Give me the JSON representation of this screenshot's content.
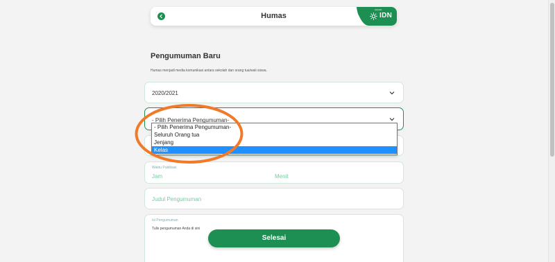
{
  "header": {
    "title": "Humas",
    "logo_small": "sekolah",
    "logo_text": "IDN"
  },
  "form": {
    "title": "Pengumuman Baru",
    "description": "Humas menjadi media komunikasi antara sekolah dan orang tua/wali siswa.",
    "year_value": "2020/2021",
    "recipient_value": "- Pilih Penerima Pengumuman-",
    "time_label": "Waktu Publikasi",
    "time_hour_placeholder": "Jam",
    "time_minute_placeholder": "Menit",
    "title_placeholder": "Judul Pengumuman",
    "content_label": "Isi Pengumuman",
    "content_placeholder": "Tulis pengumuman Anda di sini",
    "submit_label": "Selesai"
  },
  "dropdown": {
    "options": [
      "- Pilih Penerima Pengumuman-",
      "Seluruh Orang tua",
      "Jenjang",
      "Kelas"
    ],
    "highlighted_index": 3
  },
  "colors": {
    "brand_green": "#1e8f52",
    "highlight_blue": "#1e90ff",
    "annotation_orange": "#f07a2a"
  },
  "icons": [
    "back-arrow-icon",
    "chevron-down-icon",
    "sun-logo-icon"
  ]
}
